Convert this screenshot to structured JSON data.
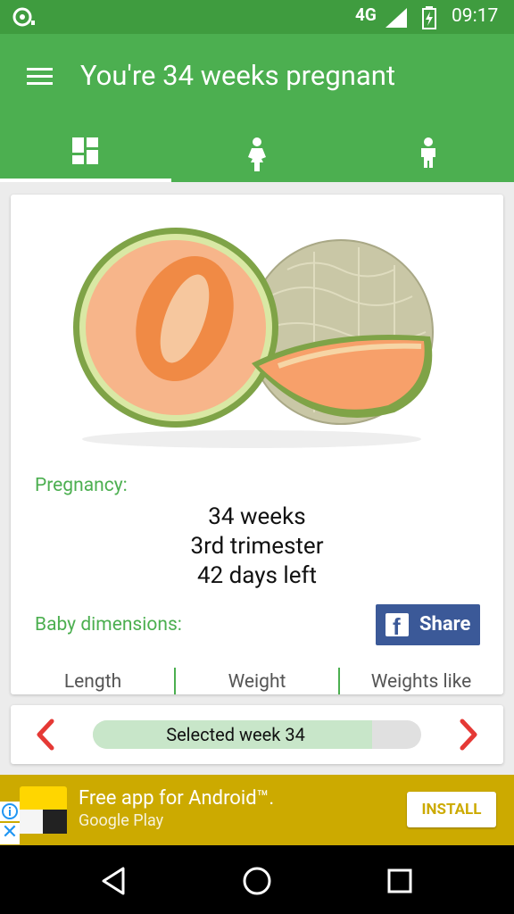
{
  "status_bar": {
    "network": "4G",
    "time": "09:17"
  },
  "app_bar": {
    "title": "You're 34 weeks pregnant"
  },
  "tabs": [
    {
      "name": "dashboard",
      "icon": "dashboard-icon",
      "selected": true
    },
    {
      "name": "mother",
      "icon": "pregnant-woman-icon",
      "selected": false
    },
    {
      "name": "baby",
      "icon": "child-icon",
      "selected": false
    }
  ],
  "card": {
    "image": "cantaloupe-melon",
    "pregnancy_label": "Pregnancy:",
    "weeks": "34 weeks",
    "trimester": "3rd trimester",
    "days_left": "42 days left",
    "baby_dimensions_label": "Baby dimensions:",
    "share_label": "Share",
    "columns": [
      "Length",
      "Weight",
      "Weights like"
    ]
  },
  "week_selector": {
    "label": "Selected week 34",
    "progress_fraction": 0.85,
    "accent": "#e53935"
  },
  "ad": {
    "title": "Free app for Android™.",
    "subtitle": "Google Play",
    "install_label": "INSTALL",
    "close_glyph": "✕"
  },
  "colors": {
    "primary": "#4caf50",
    "status_bar": "#3f9c3f",
    "facebook": "#3b5998",
    "ad_background": "#ccaa00"
  }
}
